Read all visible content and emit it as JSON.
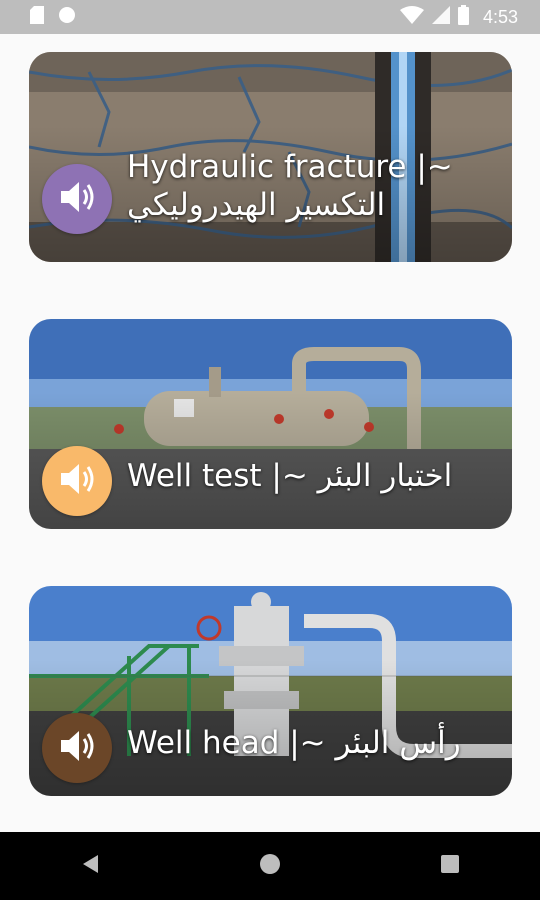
{
  "status_bar": {
    "time": "4:53",
    "icons": [
      "sd-card-icon",
      "circle-notification-icon",
      "wifi-icon",
      "signal-icon",
      "battery-icon"
    ]
  },
  "cards": [
    {
      "title_en": "Hydraulic fracture |~",
      "title_ar": "التكسير الهيدروليكي",
      "icon": "speaker-icon",
      "button_color": "#8e72b4"
    },
    {
      "title": "Well test |~ اختبار البئر",
      "icon": "speaker-icon",
      "button_color": "#f9b96a"
    },
    {
      "title": "Well head |~ رأس البئر",
      "icon": "speaker-icon",
      "button_color": "#6b4628"
    }
  ],
  "nav_bar": {
    "buttons": [
      "back-icon",
      "home-icon",
      "recents-icon"
    ]
  }
}
